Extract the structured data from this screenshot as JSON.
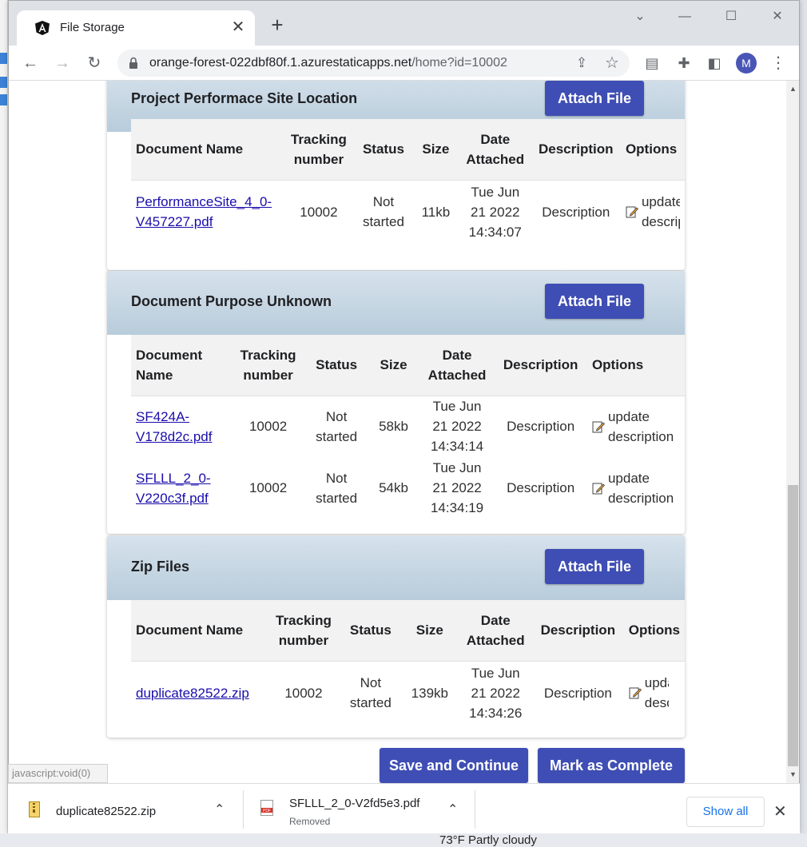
{
  "browser": {
    "tab_title": "File Storage",
    "url_domain": "orange-forest-022dbf80f.1.azurestaticapps.net",
    "url_path": "/home?id=10002",
    "avatar_letter": "M"
  },
  "columns": {
    "doc_name": "Document Name",
    "tracking": "Tracking number",
    "status": "Status",
    "size": "Size",
    "date": "Date Attached",
    "description": "Description",
    "options": "Options"
  },
  "sections": [
    {
      "title": "Project Performace Site Location",
      "attach_label": "Attach File",
      "rows": [
        {
          "name": "PerformanceSite_4_0-V457227.pdf",
          "tracking": "10002",
          "status": "Not started",
          "size": "11kb",
          "date": "Tue Jun 21 2022 14:34:07",
          "description": "Description",
          "option": "update description"
        }
      ]
    },
    {
      "title": "Document Purpose Unknown",
      "attach_label": "Attach File",
      "rows": [
        {
          "name": "SF424A-V178d2c.pdf",
          "tracking": "10002",
          "status": "Not started",
          "size": "58kb",
          "date": "Tue Jun 21 2022 14:34:14",
          "description": "Description",
          "option": "update description"
        },
        {
          "name": "SFLLL_2_0-V220c3f.pdf",
          "tracking": "10002",
          "status": "Not started",
          "size": "54kb",
          "date": "Tue Jun 21 2022 14:34:19",
          "description": "Description",
          "option": "update description"
        }
      ]
    },
    {
      "title": "Zip Files",
      "attach_label": "Attach File",
      "rows": [
        {
          "name": "duplicate82522.zip",
          "tracking": "10002",
          "status": "Not started",
          "size": "139kb",
          "date": "Tue Jun 21 2022 14:34:26",
          "description": "Description",
          "option": "update description"
        }
      ]
    }
  ],
  "actions": {
    "save_label": "Save and Continue",
    "complete_label": "Mark as Complete"
  },
  "status_link": "javascript:void(0)",
  "downloads": {
    "items": [
      {
        "name": "duplicate82522.zip",
        "sub": ""
      },
      {
        "name": "SFLLL_2_0-V2fd5e3.pdf",
        "sub": "Removed"
      }
    ],
    "show_all": "Show all"
  },
  "taskbar": {
    "weather": "73°F Partly cloudy"
  }
}
